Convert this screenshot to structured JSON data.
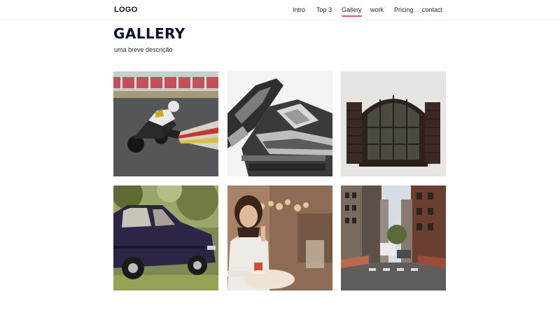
{
  "header": {
    "logo": "LOGO",
    "nav": [
      {
        "label": "Intro",
        "active": false
      },
      {
        "label": "Top 3",
        "active": false
      },
      {
        "label": "Gallery",
        "active": true
      },
      {
        "label": "work",
        "active": false
      },
      {
        "label": "Pricing",
        "active": false
      },
      {
        "label": "contact",
        "active": false
      }
    ]
  },
  "hero": {
    "title": "GALLERY",
    "description": "uma breve descrição"
  },
  "gallery": {
    "items": [
      {
        "name": "motorcycle-racer-photo"
      },
      {
        "name": "starship-model-photo"
      },
      {
        "name": "arched-window-photo"
      },
      {
        "name": "vintage-car-photo"
      },
      {
        "name": "woman-cafe-photo"
      },
      {
        "name": "city-street-photo"
      }
    ]
  },
  "colors": {
    "accent": "#e0566e",
    "text_dark": "#0b1230"
  }
}
